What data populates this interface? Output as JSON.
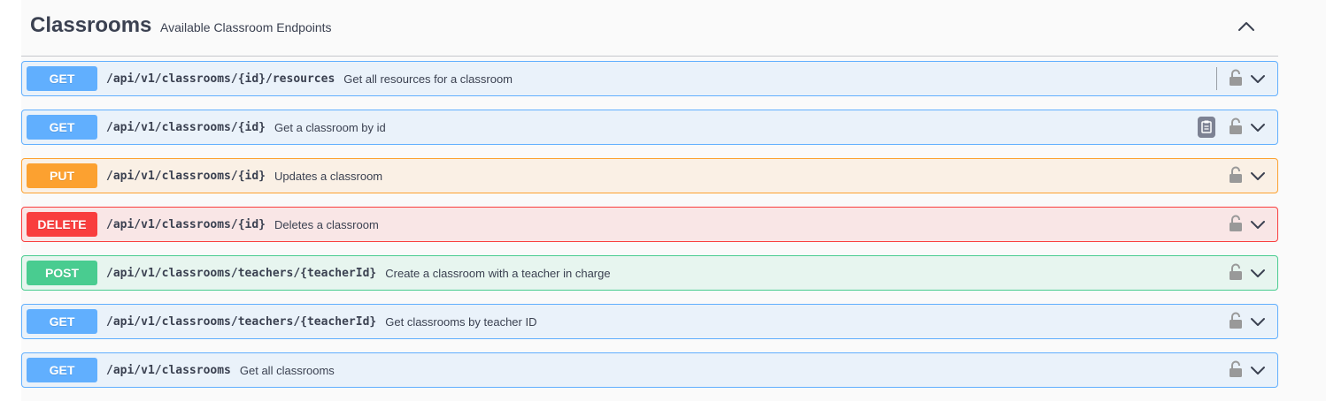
{
  "tag": {
    "title": "Classrooms",
    "description": "Available Classroom Endpoints"
  },
  "operations": [
    {
      "method": "GET",
      "path": "/api/v1/classrooms/{id}/resources",
      "summary": "Get all resources for a classroom"
    },
    {
      "method": "GET",
      "path": "/api/v1/classrooms/{id}",
      "summary": "Get a classroom by id"
    },
    {
      "method": "PUT",
      "path": "/api/v1/classrooms/{id}",
      "summary": "Updates a classroom"
    },
    {
      "method": "DELETE",
      "path": "/api/v1/classrooms/{id}",
      "summary": "Deletes a classroom"
    },
    {
      "method": "POST",
      "path": "/api/v1/classrooms/teachers/{teacherId}",
      "summary": "Create a classroom with a teacher in charge"
    },
    {
      "method": "GET",
      "path": "/api/v1/classrooms/teachers/{teacherId}",
      "summary": "Get classrooms by teacher ID"
    },
    {
      "method": "GET",
      "path": "/api/v1/classrooms",
      "summary": "Get all classrooms"
    }
  ],
  "icons": {
    "collapse": "chevron-up-icon",
    "lock": "unlocked-padlock-icon",
    "expand": "chevron-down-icon",
    "copy": "clipboard-copy-icon"
  },
  "colors": {
    "get": "#61affe",
    "put": "#fca130",
    "delete": "#f93e3e",
    "post": "#49cc90"
  }
}
